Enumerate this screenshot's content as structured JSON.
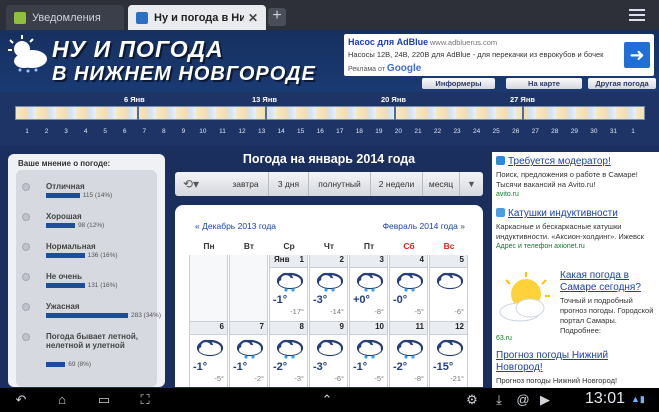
{
  "browser": {
    "tabs": [
      {
        "label": "Уведомления"
      },
      {
        "label": "Ну и погода в Ни…"
      }
    ],
    "new_tab": "+"
  },
  "site": {
    "logo_line1": "НУ И ПОГОДА",
    "logo_line2": "В НИЖНЕМ НОВГОРОДЕ"
  },
  "top_ad": {
    "title": "Насос для AdBlue",
    "url": "www.adbluerus.com",
    "text": "Насосы 12В, 24В, 220В для AdBlue - для перекачки из еврокубов и бочек",
    "by": "Реклама от",
    "google": "Google",
    "arrow": "➜"
  },
  "top_nav": [
    "Информеры",
    "На карте",
    "Другая погода"
  ],
  "strip": {
    "weeks": [
      "6 Янв",
      "13 Янв",
      "20 Янв",
      "27 Янв"
    ],
    "days": [
      "1",
      "2",
      "3",
      "4",
      "5",
      "6",
      "7",
      "8",
      "9",
      "10",
      "11",
      "12",
      "13",
      "14",
      "15",
      "16",
      "17",
      "18",
      "19",
      "20",
      "21",
      "22",
      "23",
      "24",
      "25",
      "26",
      "27",
      "28",
      "29",
      "30",
      "31",
      "1"
    ]
  },
  "poll": {
    "title": "Ваше мнение о погоде:",
    "options": [
      {
        "label": "Отличная",
        "pct": "115 (14%)",
        "value": 14
      },
      {
        "label": "Хорошая",
        "pct": "98 (12%)",
        "value": 12
      },
      {
        "label": "Нормальная",
        "pct": "136 (16%)",
        "value": 16
      },
      {
        "label": "Не очень",
        "pct": "131 (16%)",
        "value": 16
      },
      {
        "label": "Ужасная",
        "pct": "283 (34%)",
        "value": 34
      },
      {
        "label": "Погода бывает летной, нелетной и улетной",
        "pct": "69 (8%)",
        "value": 8
      }
    ]
  },
  "weather": {
    "title": "Погода на январь 2014 года",
    "tabs": [
      "завтра",
      "3 дня",
      "полнутный",
      "2 недели",
      "месяц"
    ],
    "prev": "« Декабрь 2013 года",
    "next": "Февраль 2014 года »",
    "dow": [
      "Пн",
      "Вт",
      "Ср",
      "Чт",
      "Пт",
      "Сб",
      "Вс"
    ],
    "row1": [
      {
        "day": "1",
        "mon": "Янв",
        "max": "-1°",
        "min": "-17°",
        "icon": "cloud-snow-icon"
      },
      {
        "day": "2",
        "max": "-3°",
        "min": "-14°",
        "icon": "cloud-snow-icon"
      },
      {
        "day": "3",
        "max": "+0°",
        "min": "-8°",
        "icon": "cloud-snow-icon"
      },
      {
        "day": "4",
        "max": "-0°",
        "min": "-5°",
        "icon": "cloud-snow-icon"
      },
      {
        "day": "5",
        "max": "",
        "min": "-6°",
        "icon": "cloud-icon"
      }
    ],
    "row2": [
      {
        "day": "6",
        "max": "-1°",
        "min": "-5°",
        "icon": "cloud-icon"
      },
      {
        "day": "7",
        "max": "-1°",
        "min": "-2°",
        "icon": "cloud-snow-icon"
      },
      {
        "day": "8",
        "max": "-2°",
        "min": "-3°",
        "icon": "cloud-snow-icon"
      },
      {
        "day": "9",
        "max": "-3°",
        "min": "-6°",
        "icon": "cloud-icon"
      },
      {
        "day": "10",
        "max": "-1°",
        "min": "-5°",
        "icon": "cloud-snow-icon"
      },
      {
        "day": "11",
        "max": "-2°",
        "min": "-8°",
        "icon": "cloud-snow-icon"
      },
      {
        "day": "12",
        "max": "-15°",
        "min": "-21°",
        "icon": "cloud-icon"
      }
    ]
  },
  "right_ads": [
    {
      "title": "Требуется модератор!",
      "body": "Поиск, предложения о работе в Самаре! Тысячи вакансий на Avito.ru!",
      "green": "avito.ru"
    },
    {
      "title": "Катушки индуктивности",
      "body": "Каркасные и бескаркасные катушки индуктивности. «Аксион-холдинг». Ижевск",
      "green": "Адрес и телефон  axionet.ru"
    },
    {
      "title": "Какая погода в Самаре сегодня?",
      "body": "Точный и подробный прогноз погоды. Городской портал Самары. Подробнее:",
      "green": "63.ru"
    },
    {
      "title": "Прогноз погоды Нижний Новгород!",
      "body": "Прогноз погоды Нижний Новгород!",
      "green": ""
    }
  ],
  "system": {
    "clock": "13:01"
  },
  "colors": {
    "accent": "#1a3fb0",
    "header_bg": "#16305f",
    "sunday": "#e02020"
  }
}
